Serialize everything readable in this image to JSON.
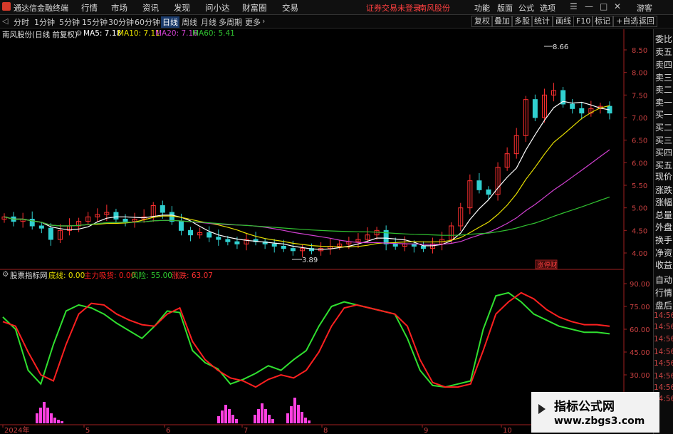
{
  "app": {
    "title": "通达信金融终端",
    "login_notice": "证券交易未登录",
    "stock_tab": "南风股份"
  },
  "menu": [
    "行情",
    "市场",
    "资讯",
    "发现",
    "问小达",
    "财富圈",
    "交易"
  ],
  "right_menu": [
    "功能",
    "版面",
    "公式",
    "选项"
  ],
  "guest_label": "游客",
  "toolbar": {
    "periods": [
      "分时",
      "1分钟",
      "5分钟",
      "15分钟",
      "30分钟",
      "60分钟",
      "日线",
      "周线",
      "月线",
      "多周期",
      "更多"
    ],
    "active_period": "日线",
    "right_buttons": [
      "复权",
      "叠加",
      "多股",
      "统计",
      "画线",
      "F10",
      "标记",
      "+自选",
      "返回"
    ]
  },
  "price_panel": {
    "title": "南风股份(日线 前复权)",
    "ma": [
      {
        "label": "MA5: 7.18",
        "color": "#ffffff"
      },
      {
        "label": "MA10: 7.11",
        "color": "#e8e000"
      },
      {
        "label": "MA20: 7.16",
        "color": "#d040d0"
      },
      {
        "label": "MA60: 5.41",
        "color": "#30c030"
      }
    ],
    "y_ticks": [
      "8.50",
      "8.00",
      "7.50",
      "7.00",
      "6.50",
      "6.00",
      "5.50",
      "5.00",
      "4.50",
      "4.00"
    ],
    "y_values": [
      8.5,
      8.0,
      7.5,
      7.0,
      6.5,
      6.0,
      5.5,
      5.0,
      4.5,
      4.0
    ],
    "high_label": "8.66",
    "low_label": "3.89",
    "event_tag": "涨停财"
  },
  "indicator_panel": {
    "name": "股票指标网",
    "items": [
      {
        "label": "底线: 0.00",
        "color": "#e8e000"
      },
      {
        "label": "主力吸货: 0.00",
        "color": "#ff2020"
      },
      {
        "label": "风险: 55.00",
        "color": "#30d030"
      },
      {
        "label": "涨跌: 63.07",
        "color": "#ff3030"
      }
    ],
    "y_ticks": [
      "90.00",
      "75.00",
      "60.00",
      "45.00",
      "30.00"
    ],
    "y_values": [
      90,
      75,
      60,
      45,
      30
    ]
  },
  "x_axis": [
    "2024年",
    "5",
    "6",
    "7",
    "8",
    "9",
    "10"
  ],
  "right_panel": [
    "委比",
    "卖五",
    "卖四",
    "卖三",
    "卖二",
    "卖一",
    "买一",
    "买二",
    "买三",
    "买四",
    "买五",
    "现价",
    "涨跌",
    "涨幅",
    "总量",
    "外盘",
    "换手",
    "净资",
    "收益",
    "自动",
    "行情",
    "盘后",
    "14:56",
    "14:56",
    "14:56",
    "14:56",
    "14:56",
    "14:56",
    "14:56",
    "14:56"
  ],
  "watermark": {
    "title": "指标公式网",
    "url": "www.zbgs3.com"
  },
  "colors": {
    "up": "#ff3030",
    "down": "#30d0d0",
    "ma5": "#ffffff",
    "ma10": "#e8e000",
    "ma20": "#d040d0",
    "ma60": "#30c030",
    "green_line": "#30e030",
    "red_line": "#ff2020",
    "bars": "#ff40e0"
  },
  "chart_data": {
    "type": "line",
    "price_series": {
      "name": "南风股份",
      "close_approx": [
        4.8,
        4.7,
        4.75,
        4.6,
        4.55,
        4.3,
        4.5,
        4.6,
        4.7,
        4.8,
        4.85,
        4.9,
        4.75,
        4.7,
        4.75,
        4.8,
        5.05,
        4.9,
        4.7,
        4.5,
        4.4,
        4.45,
        4.35,
        4.3,
        4.25,
        4.2,
        4.3,
        4.25,
        4.2,
        4.15,
        4.1,
        4.05,
        4.1,
        4.05,
        4.1,
        4.15,
        4.2,
        4.25,
        4.3,
        4.4,
        4.5,
        4.2,
        4.15,
        4.2,
        4.15,
        4.1,
        4.2,
        4.3,
        4.6,
        5.0,
        5.6,
        5.4,
        5.3,
        5.9,
        6.2,
        6.6,
        7.4,
        7.0,
        7.5,
        7.6,
        7.3,
        7.2,
        7.1,
        7.2,
        7.25,
        7.1
      ],
      "high": 8.66,
      "low": 3.89
    },
    "indicator_series": [
      {
        "name": "风险",
        "values": [
          68,
          60,
          33,
          24,
          50,
          72,
          76,
          74,
          70,
          64,
          59,
          54,
          62,
          72,
          71,
          46,
          38,
          34,
          24,
          27,
          31,
          36,
          33,
          40,
          46,
          62,
          75,
          78,
          76,
          74,
          72,
          70,
          54,
          33,
          23,
          22,
          24,
          26,
          60,
          82,
          84,
          78,
          70,
          66,
          62,
          60,
          58,
          58,
          57
        ]
      },
      {
        "name": "涨跌",
        "values": [
          65,
          62,
          45,
          30,
          26,
          50,
          70,
          77,
          76,
          70,
          66,
          63,
          62,
          70,
          74,
          52,
          40,
          33,
          28,
          26,
          22,
          27,
          30,
          28,
          33,
          45,
          62,
          74,
          76,
          74,
          72,
          70,
          62,
          40,
          25,
          22,
          22,
          24,
          46,
          70,
          78,
          84,
          80,
          73,
          68,
          65,
          63,
          63,
          62
        ]
      }
    ],
    "bars_label": "主力吸货",
    "x_ticks": [
      "2024年",
      "5",
      "6",
      "7",
      "8",
      "9",
      "10"
    ]
  }
}
